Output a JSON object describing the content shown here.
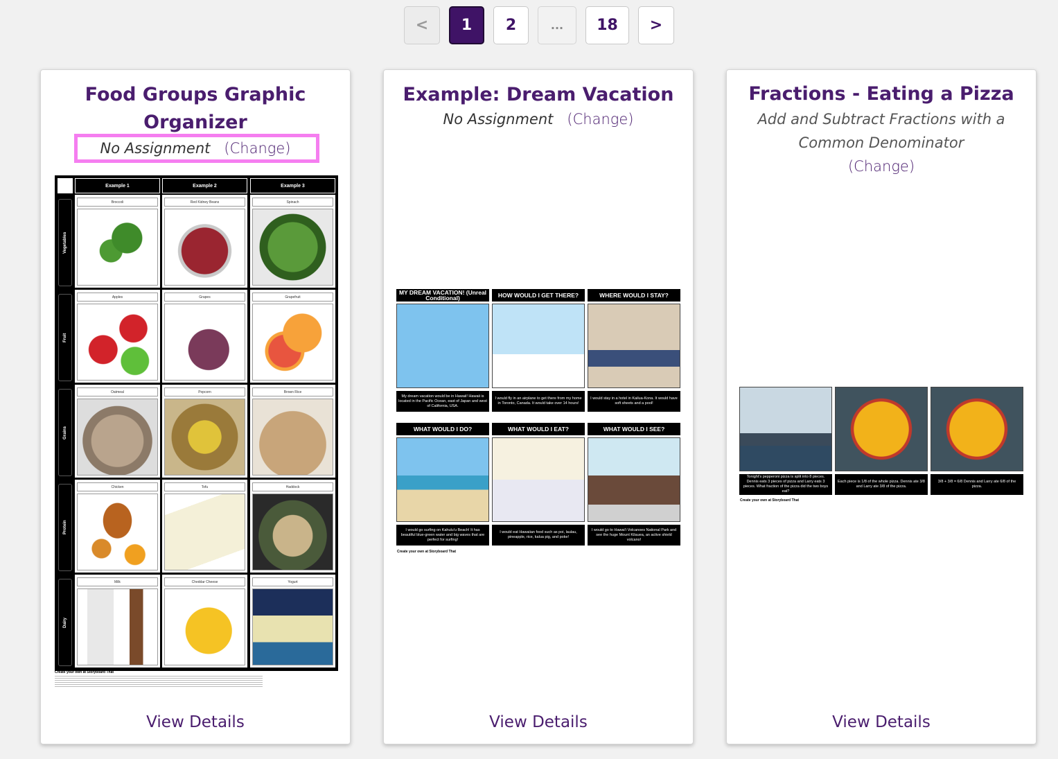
{
  "pagination": {
    "prev": "<",
    "pages": [
      "1",
      "2",
      "...",
      "18"
    ],
    "active": "1",
    "next": ">"
  },
  "cards": [
    {
      "title": "Food Groups Graphic Organizer",
      "assignment": "No Assignment",
      "change": "(Change)",
      "view_details": "View Details",
      "organizer": {
        "columns": [
          "Example 1",
          "Example 2",
          "Example 3"
        ],
        "rows": [
          {
            "group": "Vegetables",
            "items": [
              "Broccoli",
              "Red Kidney Beans",
              "Spinach"
            ]
          },
          {
            "group": "Fruit",
            "items": [
              "Apples",
              "Grapes",
              "Grapefruit"
            ]
          },
          {
            "group": "Grains",
            "items": [
              "Oatmeal",
              "Popcorn",
              "Brown Rice"
            ]
          },
          {
            "group": "Protein",
            "items": [
              "Chicken",
              "Tofu",
              "Haddock"
            ]
          },
          {
            "group": "Dairy",
            "items": [
              "Milk",
              "Cheddar Cheese",
              "Yogurt"
            ]
          }
        ],
        "credit": "Create your own at Storyboard That"
      }
    },
    {
      "title": "Example: Dream Vacation",
      "assignment": "No Assignment",
      "change": "(Change)",
      "view_details": "View Details",
      "storyboard": {
        "panels": [
          {
            "heading": "MY DREAM VACATION! (Unreal Conditional)",
            "caption": "My dream vacation would be in Hawaii! Hawaii is located in the Pacific Ocean, east of Japan and west of California, USA."
          },
          {
            "heading": "HOW WOULD I GET THERE?",
            "caption": "I would fly in an airplane to get there from my home in Toronto, Canada. It would take over 14 hours!"
          },
          {
            "heading": "WHERE WOULD I STAY?",
            "caption": "I would stay in a hotel in Kailua-Kona. It would have soft sheets and a pool!"
          },
          {
            "heading": "WHAT WOULD I DO?",
            "caption": "I would go surfing on Kahulu'u Beach! It has beautiful blue-green water and big waves that are perfect for surfing!"
          },
          {
            "heading": "WHAT WOULD I EAT?",
            "caption": "I would eat Hawaiian food such as poi, laulau, pineapple, rice, kalua pig, and poke!"
          },
          {
            "heading": "WHAT WOULD I SEE?",
            "caption": "I would go to Hawai'i Volcanoes National Park and see the huge Mount Kilauea, an active shield volcano!"
          }
        ],
        "credit": "Create your own at Storyboard That"
      }
    },
    {
      "title": "Fractions - Eating a Pizza",
      "assignment": "Add and Subtract Fractions with a Common Denominator",
      "change": "(Change)",
      "view_details": "View Details",
      "storyboard": {
        "panels": [
          {
            "caption": "Tonight's pepperoni pizza is split into 8 pieces. Dennis eats 3 pieces of pizza and Larry eats 3 pieces. What fraction of the pizza did the two boys eat?"
          },
          {
            "caption": "Each piece is 1/8 of the whole pizza. Dennis ate 3/8 and Larry ate 3/8 of the pizza."
          },
          {
            "caption": "3/8 + 3/8 = 6/8 Dennis and Larry ate 6/8 of the pizza."
          }
        ],
        "credit": "Create your own at Storyboard That"
      }
    }
  ],
  "colors": {
    "brand_purple": "#4a1d6e",
    "active_page": "#3f1366",
    "highlight": "#f57ef0",
    "background": "#f1f1f1"
  }
}
